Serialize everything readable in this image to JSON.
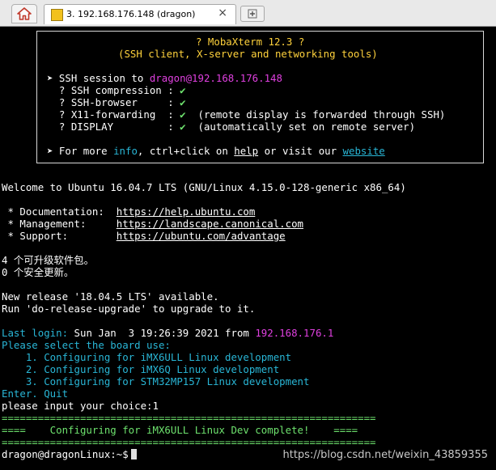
{
  "tabs": {
    "active_title": "3. 192.168.176.148 (dragon)",
    "close_glyph": "×",
    "home_icon": "house-icon",
    "tab_icon": "terminal-icon",
    "newtab_icon": "plus-icon"
  },
  "banner": {
    "title": "? MobaXterm 12.3 ?",
    "subtitle": "(SSH client, X-server and networking tools)",
    "session_prefix": "➤ SSH session to ",
    "user": "dragon",
    "at_host": "@192.168.176.148",
    "rows": [
      {
        "label": "  ? SSH compression : ",
        "check": "✔",
        "note": ""
      },
      {
        "label": "  ? SSH-browser     : ",
        "check": "✔",
        "note": ""
      },
      {
        "label": "  ? X11-forwarding  : ",
        "check": "✔",
        "note": "  (remote display is forwarded through SSH)"
      },
      {
        "label": "  ? DISPLAY         : ",
        "check": "✔",
        "note": "  (automatically set on remote server)"
      }
    ],
    "more_prefix": "➤ For more ",
    "info": "info",
    "more_mid": ", ctrl+click on ",
    "help": "help",
    "more_mid2": " or visit our ",
    "website": "website"
  },
  "welcome": "Welcome to Ubuntu 16.04.7 LTS (GNU/Linux 4.15.0-128-generic x86_64)",
  "links": [
    {
      "label": " * Documentation:  ",
      "url": "https://help.ubuntu.com"
    },
    {
      "label": " * Management:     ",
      "url": "https://landscape.canonical.com"
    },
    {
      "label": " * Support:        ",
      "url": "https://ubuntu.com/advantage"
    }
  ],
  "updates": [
    "4 个可升级软件包。",
    "0 个安全更新。"
  ],
  "release": [
    "New release '18.04.5 LTS' available.",
    "Run 'do-release-upgrade' to upgrade to it."
  ],
  "last_login_label": "Last login: ",
  "last_login_time": "Sun Jan  3 19:26:39 2021",
  "last_login_from": " from ",
  "last_login_ip": "192.168.176.1",
  "menu": {
    "header": "Please select the board use:",
    "options": [
      "    1. Configuring for iMX6ULL Linux development",
      "    2. Configuring for iMX6Q Linux development",
      "    3. Configuring for STM32MP157 Linux development"
    ],
    "quit": "Enter. Quit"
  },
  "choice_line": "please input your choice:1",
  "separator": "==============================================================",
  "configured": "====    Configuring for iMX6ULL Linux Dev complete!    ====",
  "prompt": "dragon@dragonLinux:~$",
  "watermark": "https://blog.csdn.net/weixin_43859355",
  "colors": {
    "background": "#000000",
    "text": "#ffffff",
    "yellow": "#ffd23c",
    "magenta": "#e040e0",
    "green": "#6ee26e",
    "cyan": "#29b6d6"
  }
}
